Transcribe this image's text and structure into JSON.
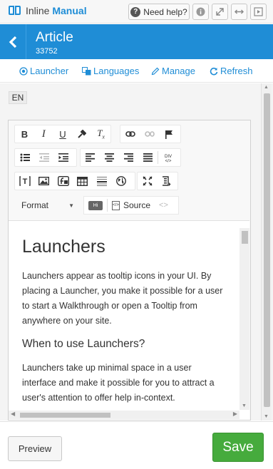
{
  "app": {
    "brand_plain": "Inline",
    "brand_bold": "Manual",
    "help_label": "Need help?",
    "help_icon": "question-circle-icon",
    "window_icons": [
      "info-icon",
      "expand-icon",
      "resize-horizontal-icon",
      "play-icon"
    ]
  },
  "header": {
    "title": "Article",
    "id": "33752",
    "color": "#1f8dd6"
  },
  "nav": {
    "launcher": "Launcher",
    "languages": "Languages",
    "manage": "Manage",
    "refresh": "Refresh"
  },
  "language_tag": "EN",
  "toolbar": {
    "row1": [
      "bold-icon",
      "italic-icon",
      "underline-icon",
      "paint-format-icon",
      "clear-format-icon",
      "link-icon",
      "unlink-icon",
      "flag-icon"
    ],
    "row2": [
      "bulleted-list-icon",
      "outdent-icon",
      "indent-icon",
      "align-left-icon",
      "align-center-icon",
      "align-right-icon",
      "justify-icon",
      "div-icon"
    ],
    "row3": [
      "text-box-icon",
      "image-icon",
      "flash-icon",
      "table-icon",
      "horizontal-line-icon",
      "globe-icon",
      "maximize-icon",
      "show-blocks-icon"
    ],
    "format_label": "Format",
    "hi_label": "Hi",
    "source_label": "Source",
    "code_label": "<>"
  },
  "document": {
    "heading": "Launchers",
    "para1": "Launchers appear as tooltip icons in your UI. By placing a Launcher, you make it possible for a user to start a Walkthrough or open a Tooltip from anywhere on your site.",
    "subheading": "When to use Launchers?",
    "para2": "Launchers take up minimal space in a user interface and make it possible for you to attract a user's attention to offer help in-context."
  },
  "footer": {
    "preview": "Preview",
    "save": "Save",
    "save_color": "#46ab3d"
  }
}
